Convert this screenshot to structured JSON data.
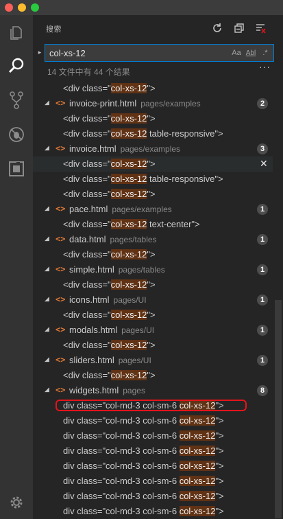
{
  "panel": {
    "title": "搜索"
  },
  "search": {
    "query": "col-xs-12",
    "summary": "14 文件中有 44 个结果"
  },
  "options": {
    "match_case": "Aa",
    "whole_word": "Abl",
    "regex": ".*"
  },
  "rows": [
    {
      "type": "match",
      "pre": "<div class=\"",
      "hl": "col-xs-12",
      "post": "\">"
    },
    {
      "type": "file",
      "name": "invoice-print.html",
      "path": "pages/examples",
      "count": "2"
    },
    {
      "type": "match",
      "pre": "<div class=\"",
      "hl": "col-xs-12",
      "post": "\">"
    },
    {
      "type": "match",
      "pre": "<div class=\"",
      "hl": "col-xs-12",
      "post": " table-responsive\">"
    },
    {
      "type": "file",
      "name": "invoice.html",
      "path": "pages/examples",
      "count": "3"
    },
    {
      "type": "match",
      "pre": "<div class=\"",
      "hl": "col-xs-12",
      "post": "\">",
      "selected": true
    },
    {
      "type": "match",
      "pre": "<div class=\"",
      "hl": "col-xs-12",
      "post": " table-responsive\">"
    },
    {
      "type": "match",
      "pre": "<div class=\"",
      "hl": "col-xs-12",
      "post": "\">"
    },
    {
      "type": "file",
      "name": "pace.html",
      "path": "pages/examples",
      "count": "1"
    },
    {
      "type": "match",
      "pre": "<div class=\"",
      "hl": "col-xs-12",
      "post": " text-center\">"
    },
    {
      "type": "file",
      "name": "data.html",
      "path": "pages/tables",
      "count": "1"
    },
    {
      "type": "match",
      "pre": "<div class=\"",
      "hl": "col-xs-12",
      "post": "\">"
    },
    {
      "type": "file",
      "name": "simple.html",
      "path": "pages/tables",
      "count": "1"
    },
    {
      "type": "match",
      "pre": "<div class=\"",
      "hl": "col-xs-12",
      "post": "\">"
    },
    {
      "type": "file",
      "name": "icons.html",
      "path": "pages/UI",
      "count": "1"
    },
    {
      "type": "match",
      "pre": "<div class=\"",
      "hl": "col-xs-12",
      "post": "\">"
    },
    {
      "type": "file",
      "name": "modals.html",
      "path": "pages/UI",
      "count": "1"
    },
    {
      "type": "match",
      "pre": "<div class=\"",
      "hl": "col-xs-12",
      "post": "\">"
    },
    {
      "type": "file",
      "name": "sliders.html",
      "path": "pages/UI",
      "count": "1"
    },
    {
      "type": "match",
      "pre": "<div class=\"",
      "hl": "col-xs-12",
      "post": "\">"
    },
    {
      "type": "file",
      "name": "widgets.html",
      "path": "pages",
      "count": "8"
    },
    {
      "type": "match",
      "pre": "div class=\"col-md-3 col-sm-6 ",
      "hl": "col-xs-12",
      "post": "\">",
      "annotated": true
    },
    {
      "type": "match",
      "pre": "div class=\"col-md-3 col-sm-6 ",
      "hl": "col-xs-12",
      "post": "\">"
    },
    {
      "type": "match",
      "pre": "div class=\"col-md-3 col-sm-6 ",
      "hl": "col-xs-12",
      "post": "\">"
    },
    {
      "type": "match",
      "pre": "div class=\"col-md-3 col-sm-6 ",
      "hl": "col-xs-12",
      "post": "\">"
    },
    {
      "type": "match",
      "pre": "div class=\"col-md-3 col-sm-6 ",
      "hl": "col-xs-12",
      "post": "\">"
    },
    {
      "type": "match",
      "pre": "div class=\"col-md-3 col-sm-6 ",
      "hl": "col-xs-12",
      "post": "\">"
    },
    {
      "type": "match",
      "pre": "div class=\"col-md-3 col-sm-6 ",
      "hl": "col-xs-12",
      "post": "\">"
    },
    {
      "type": "match",
      "pre": "div class=\"col-md-3 col-sm-6 ",
      "hl": "col-xs-12",
      "post": "\">"
    }
  ],
  "icons": {
    "twistie_open": "◢",
    "twistie_closed": "▸",
    "file": "<>",
    "dismiss": "✕",
    "more": "···"
  },
  "colors": {
    "accent": "#007fd4",
    "match_highlight": "#613214",
    "file_icon": "#e37933",
    "annotation": "#e4141b"
  }
}
